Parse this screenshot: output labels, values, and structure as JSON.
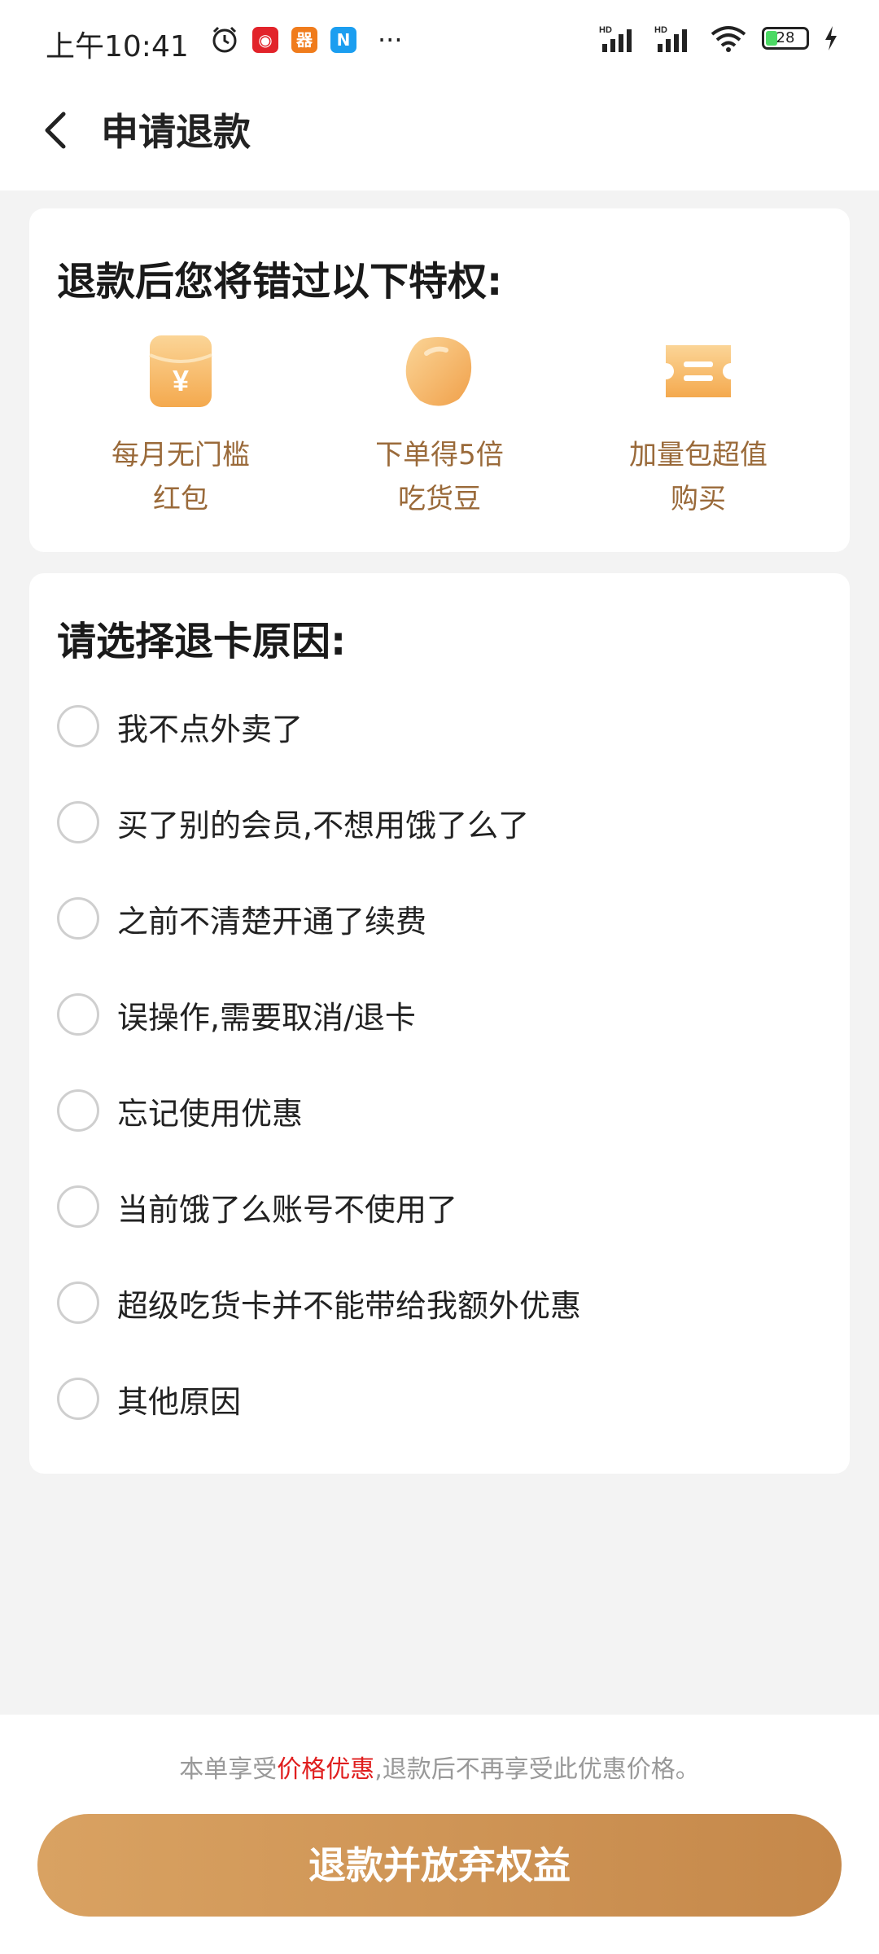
{
  "status_bar": {
    "time": "上午10:41",
    "battery": "28",
    "more": "···",
    "app_icons": [
      "netease-music-icon",
      "app-icon-orange",
      "app-icon-n"
    ]
  },
  "header": {
    "title": "申请退款"
  },
  "privileges_card": {
    "title": "退款后您将错过以下特权:",
    "items": [
      {
        "line1": "每月无门槛",
        "line2": "红包",
        "icon": "red-envelope-icon"
      },
      {
        "line1": "下单得5倍",
        "line2": "吃货豆",
        "icon": "bean-icon"
      },
      {
        "line1": "加量包超值",
        "line2": "购买",
        "icon": "coupon-ticket-icon"
      }
    ]
  },
  "reasons_card": {
    "title": "请选择退卡原因:",
    "options": [
      "我不点外卖了",
      "买了别的会员,不想用饿了么了",
      "之前不清楚开通了续费",
      "误操作,需要取消/退卡",
      "忘记使用优惠",
      "当前饿了么账号不使用了",
      "超级吃货卡并不能带给我额外优惠",
      "其他原因"
    ]
  },
  "footer": {
    "notice_before": "本单享受",
    "notice_highlight": "价格优惠",
    "notice_after": ",退款后不再享受此优惠价格。",
    "button_label": "退款并放弃权益"
  },
  "colors": {
    "accent_gold": "#c5884a",
    "label_brown": "#9a6a3a",
    "highlight_red": "#e01e1e"
  }
}
